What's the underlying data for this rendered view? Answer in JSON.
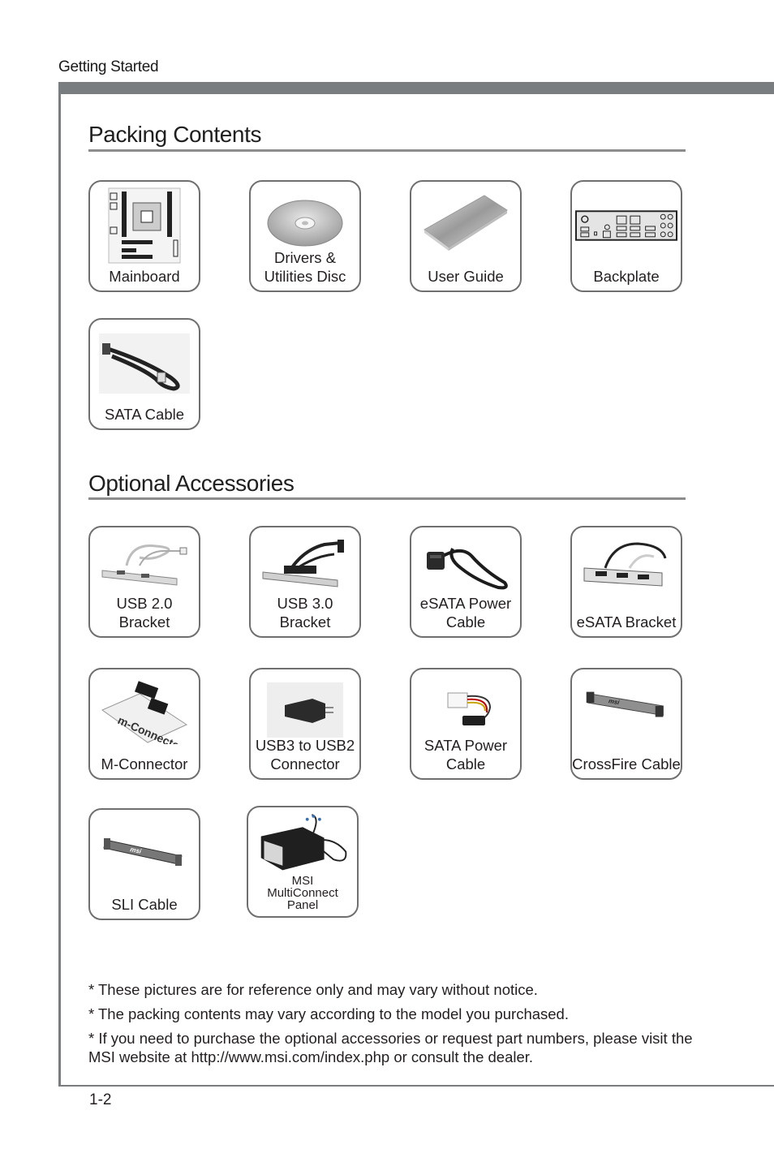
{
  "header": {
    "section_label": "Getting Started"
  },
  "packing_contents": {
    "title": "Packing Contents",
    "items": [
      {
        "label": "Mainboard",
        "icon": "mainboard-icon"
      },
      {
        "label": "Drivers & Utilities Disc",
        "icon": "disc-icon"
      },
      {
        "label": "User Guide",
        "icon": "manual-icon"
      },
      {
        "label": "Backplate",
        "icon": "io-backplate-icon"
      },
      {
        "label": "SATA Cable",
        "icon": "sata-cable-icon"
      }
    ]
  },
  "optional_accessories": {
    "title": "Optional Accessories",
    "items": [
      {
        "label": "USB 2.0 Bracket",
        "icon": "usb2-bracket-icon"
      },
      {
        "label": "USB 3.0 Bracket",
        "icon": "usb3-bracket-icon"
      },
      {
        "label": "eSATA Power Cable",
        "icon": "esata-power-cable-icon"
      },
      {
        "label": "eSATA Bracket",
        "icon": "esata-bracket-icon"
      },
      {
        "label": "M-Connector",
        "icon": "m-connector-icon"
      },
      {
        "label": "USB3 to USB2 Connector",
        "icon": "usb-adapter-icon"
      },
      {
        "label": "SATA Power Cable",
        "icon": "sata-power-cable-icon"
      },
      {
        "label": "CrossFire Cable",
        "icon": "crossfire-bridge-icon"
      },
      {
        "label": "SLI Cable",
        "icon": "sli-bridge-icon"
      },
      {
        "label": "MSI MultiConnect Panel",
        "icon": "multiconnect-panel-icon"
      }
    ]
  },
  "notes": [
    "* These pictures are for reference only and may vary without notice.",
    "* The packing contents may vary according to the model you purchased.",
    "* If you need to purchase the optional accessories or request part numbers, please visit the MSI website at http://www.msi.com/index.php or consult the dealer."
  ],
  "footer": {
    "page_number": "1-2"
  }
}
